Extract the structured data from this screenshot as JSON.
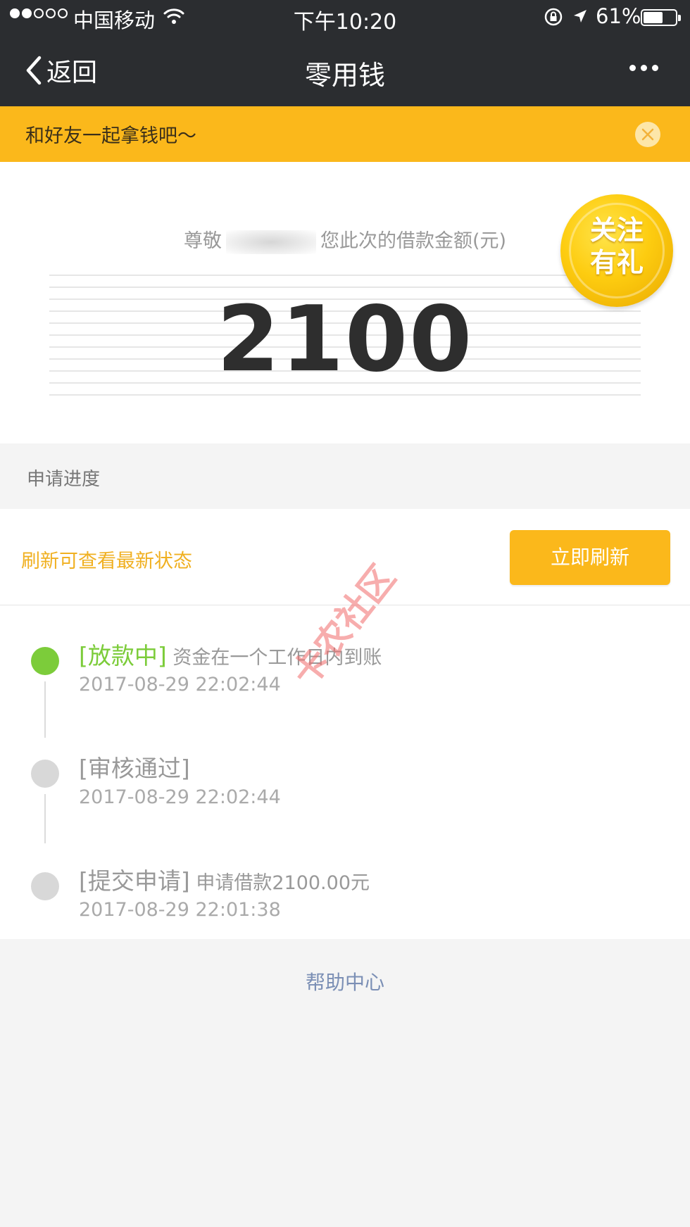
{
  "status_bar": {
    "carrier": "中国移动",
    "time": "下午10:20",
    "battery_percent": "61%",
    "battery_level": 0.61,
    "signal_strength": 2,
    "signal_max": 5
  },
  "nav": {
    "back_label": "返回",
    "title": "零用钱"
  },
  "banner": {
    "text": "和好友一起拿钱吧～"
  },
  "amount_card": {
    "greeting_prefix": "尊敬",
    "greeting_suffix": "您此次的借款金额(元)",
    "amount": "2100"
  },
  "badge": {
    "line1": "关注",
    "line2": "有礼"
  },
  "progress_section": {
    "title": "申请进度",
    "refresh_hint": "刷新可查看最新状态",
    "refresh_button": "立即刷新"
  },
  "timeline": [
    {
      "status": "[放款中]",
      "detail": "资金在一个工作日内到账",
      "time": "2017-08-29 22:02:44",
      "active": true
    },
    {
      "status": "[审核通过]",
      "detail": "",
      "time": "2017-08-29 22:02:44",
      "active": false
    },
    {
      "status": "[提交申请]",
      "detail": "申请借款2100.00元",
      "time": "2017-08-29 22:01:38",
      "active": false
    }
  ],
  "footer": {
    "help_link": "帮助中心"
  },
  "watermark": {
    "text": "卡农社区"
  },
  "colors": {
    "accent_yellow": "#fbb81b",
    "active_green": "#7ccc3a",
    "dark_bar": "#2b2d30",
    "link_blue": "#7b8fb5"
  }
}
